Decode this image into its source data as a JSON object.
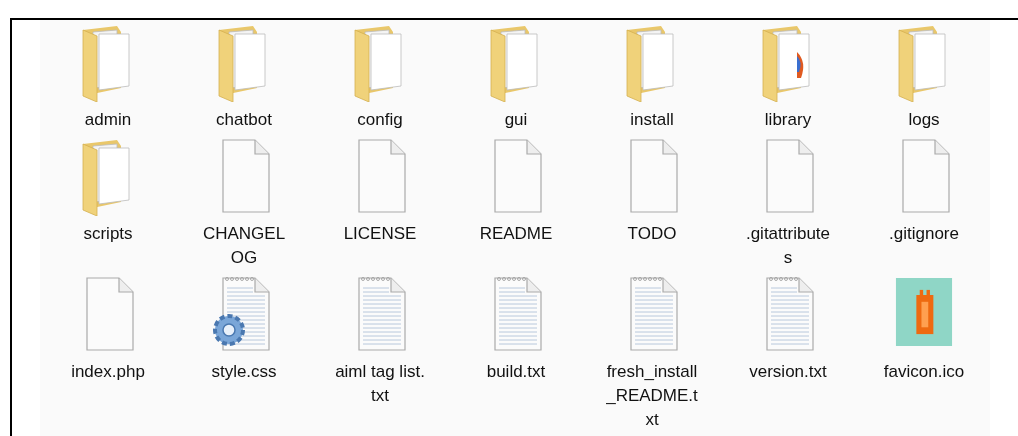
{
  "items": [
    {
      "name": "admin",
      "kind": "folder"
    },
    {
      "name": "chatbot",
      "kind": "folder"
    },
    {
      "name": "config",
      "kind": "folder"
    },
    {
      "name": "gui",
      "kind": "folder"
    },
    {
      "name": "install",
      "kind": "folder"
    },
    {
      "name": "library",
      "kind": "folder-image"
    },
    {
      "name": "logs",
      "kind": "folder"
    },
    {
      "name": "scripts",
      "kind": "folder"
    },
    {
      "name": "CHANGELOG",
      "kind": "file"
    },
    {
      "name": "LICENSE",
      "kind": "file"
    },
    {
      "name": "README",
      "kind": "file"
    },
    {
      "name": "TODO",
      "kind": "file"
    },
    {
      "name": ".gitattributes",
      "kind": "file"
    },
    {
      "name": ".gitignore",
      "kind": "file"
    },
    {
      "name": "index.php",
      "kind": "file"
    },
    {
      "name": "style.css",
      "kind": "css"
    },
    {
      "name": "aiml tag list.txt",
      "kind": "text"
    },
    {
      "name": "build.txt",
      "kind": "text"
    },
    {
      "name": "fresh_install_README.txt",
      "kind": "text"
    },
    {
      "name": "version.txt",
      "kind": "text"
    },
    {
      "name": "favicon.ico",
      "kind": "image"
    }
  ]
}
